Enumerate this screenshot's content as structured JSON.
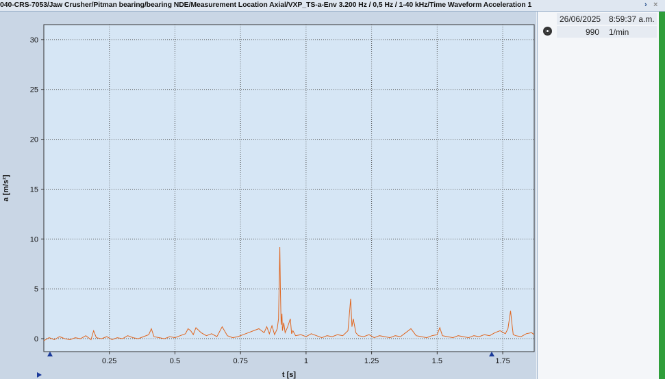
{
  "window": {
    "title": "040-CRS-7053/Jaw Crusher/Pitman bearing/bearing NDE/Measurement Location Axial/VXP_TS-a-Env 3.200 Hz / 0,5 Hz / 1-40 kHz/Time Waveform Acceleration 1",
    "expand_glyph": "›",
    "close_glyph": "×"
  },
  "info_panel": {
    "date": "26/06/2025",
    "time": "8:59:37 a.m.",
    "speed_value": "990",
    "speed_unit": "1/min",
    "icon": "speed-icon"
  },
  "chart_data": {
    "type": "line",
    "xlabel": "t [s]",
    "ylabel": "a [m/s²]",
    "xlim": [
      0,
      1.87
    ],
    "ylim": [
      -1.3,
      31.5
    ],
    "x_ticks": [
      0.25,
      0.5,
      0.75,
      1,
      1.25,
      1.5,
      1.75
    ],
    "x_tick_labels": [
      "0.25",
      "0.5",
      "0.75",
      "1",
      "1.25",
      "1.5",
      "1.75"
    ],
    "y_ticks": [
      0,
      5,
      10,
      15,
      20,
      25,
      30
    ],
    "y_tick_labels": [
      "0",
      "5",
      "10",
      "15",
      "20",
      "25",
      "30"
    ],
    "grid": true,
    "line_color": "#e0651e",
    "background_color": "#d6e6f5",
    "series": [
      {
        "name": "",
        "x": [
          0.0,
          0.02,
          0.04,
          0.06,
          0.08,
          0.1,
          0.12,
          0.14,
          0.16,
          0.18,
          0.19,
          0.2,
          0.22,
          0.24,
          0.26,
          0.28,
          0.3,
          0.32,
          0.34,
          0.36,
          0.38,
          0.4,
          0.41,
          0.42,
          0.44,
          0.46,
          0.48,
          0.5,
          0.52,
          0.54,
          0.55,
          0.56,
          0.57,
          0.58,
          0.6,
          0.62,
          0.64,
          0.66,
          0.68,
          0.7,
          0.72,
          0.74,
          0.76,
          0.78,
          0.8,
          0.82,
          0.84,
          0.85,
          0.86,
          0.87,
          0.88,
          0.89,
          0.895,
          0.9,
          0.902,
          0.905,
          0.908,
          0.91,
          0.915,
          0.92,
          0.93,
          0.94,
          0.945,
          0.95,
          0.96,
          0.98,
          1.0,
          1.02,
          1.04,
          1.06,
          1.08,
          1.1,
          1.12,
          1.14,
          1.16,
          1.17,
          1.175,
          1.18,
          1.19,
          1.2,
          1.22,
          1.24,
          1.26,
          1.28,
          1.3,
          1.32,
          1.34,
          1.36,
          1.38,
          1.4,
          1.42,
          1.44,
          1.46,
          1.48,
          1.5,
          1.51,
          1.52,
          1.54,
          1.56,
          1.58,
          1.6,
          1.62,
          1.64,
          1.66,
          1.68,
          1.7,
          1.72,
          1.74,
          1.76,
          1.77,
          1.78,
          1.785,
          1.79,
          1.8,
          1.82,
          1.84,
          1.86,
          1.87
        ],
        "values": [
          -0.2,
          0.1,
          -0.1,
          0.2,
          0.0,
          -0.1,
          0.1,
          0.0,
          0.3,
          -0.1,
          0.8,
          0.1,
          0.0,
          0.2,
          -0.1,
          0.1,
          0.0,
          0.3,
          0.1,
          0.0,
          0.2,
          0.4,
          1.0,
          0.2,
          0.1,
          0.0,
          0.2,
          0.1,
          0.3,
          0.5,
          1.0,
          0.8,
          0.4,
          1.1,
          0.6,
          0.3,
          0.5,
          0.2,
          1.2,
          0.3,
          0.1,
          0.2,
          0.4,
          0.6,
          0.8,
          1.0,
          0.6,
          1.2,
          0.5,
          1.3,
          0.4,
          1.0,
          2.0,
          9.2,
          5.0,
          1.4,
          2.5,
          0.8,
          1.6,
          0.6,
          1.2,
          2.0,
          0.5,
          0.8,
          0.3,
          0.4,
          0.2,
          0.5,
          0.3,
          0.1,
          0.3,
          0.2,
          0.4,
          0.3,
          0.8,
          4.0,
          1.2,
          2.0,
          0.6,
          0.3,
          0.2,
          0.4,
          0.1,
          0.3,
          0.2,
          0.1,
          0.3,
          0.2,
          0.6,
          1.0,
          0.3,
          0.2,
          0.1,
          0.3,
          0.4,
          1.1,
          0.3,
          0.2,
          0.1,
          0.3,
          0.2,
          0.1,
          0.3,
          0.2,
          0.4,
          0.3,
          0.6,
          0.8,
          0.5,
          1.0,
          2.8,
          1.5,
          0.4,
          0.3,
          0.2,
          0.5,
          0.6,
          0.4
        ]
      }
    ]
  }
}
